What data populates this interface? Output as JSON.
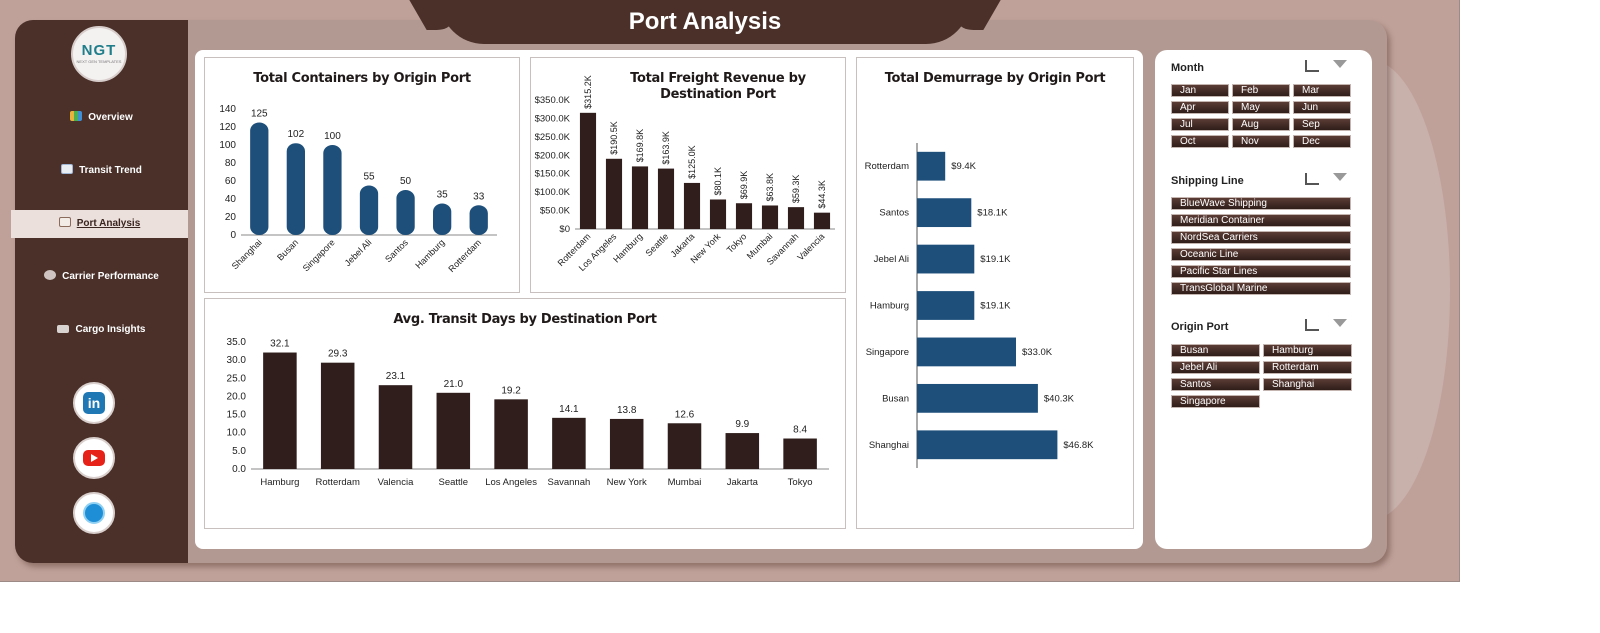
{
  "page_title": "Port Analysis",
  "logo": {
    "text": "NGT",
    "tagline": "NEXT GEN TEMPLATES"
  },
  "nav": [
    {
      "label": "Overview",
      "icon": "bar-chart-icon",
      "active": false
    },
    {
      "label": "Transit Trend",
      "icon": "line-chart-icon",
      "active": false
    },
    {
      "label": "Port Analysis",
      "icon": "document-icon",
      "active": true
    },
    {
      "label": "Carrier Performance",
      "icon": "gear-icon",
      "active": false
    },
    {
      "label": "Cargo Insights",
      "icon": "folder-icon",
      "active": false
    }
  ],
  "social": [
    {
      "icon": "linkedin-icon",
      "color": "#1f78b4"
    },
    {
      "icon": "youtube-icon",
      "color": "#e62117"
    },
    {
      "icon": "globe-icon",
      "color": "#1e8fd6"
    }
  ],
  "colors": {
    "brown_dark": "#4a3029",
    "bar_blue": "#1d4f7a",
    "bar_brown": "#2f1e1b"
  },
  "filters": {
    "month": {
      "title": "Month",
      "items": [
        "Jan",
        "Feb",
        "Mar",
        "Apr",
        "May",
        "Jun",
        "Jul",
        "Aug",
        "Sep",
        "Oct",
        "Nov",
        "Dec"
      ]
    },
    "shipping_line": {
      "title": "Shipping Line",
      "items": [
        "BlueWave Shipping",
        "Meridian Container",
        "NordSea Carriers",
        "Oceanic Line",
        "Pacific Star Lines",
        "TransGlobal Marine"
      ]
    },
    "origin_port": {
      "title": "Origin Port",
      "items": [
        "Busan",
        "Hamburg",
        "Jebel Ali",
        "Rotterdam",
        "Santos",
        "Shanghai",
        "Singapore"
      ]
    }
  },
  "chart_data": [
    {
      "type": "bar",
      "title": "Total Containers by Origin Port",
      "categories": [
        "Shanghai",
        "Busan",
        "Singapore",
        "Jebel Ali",
        "Santos",
        "Hamburg",
        "Rotterdam"
      ],
      "values": [
        125,
        102,
        100,
        55,
        50,
        35,
        33
      ],
      "labels": [
        "125",
        "102",
        "100",
        "55",
        "50",
        "35",
        "33"
      ],
      "yticks": [
        "0",
        "20",
        "40",
        "60",
        "80",
        "100",
        "120",
        "140"
      ],
      "ylim": [
        0,
        140
      ],
      "grid": false
    },
    {
      "type": "bar",
      "title": "Total Freight Revenue by Destination Port",
      "categories": [
        "Rotterdam",
        "Los Angeles",
        "Hamburg",
        "Seattle",
        "Jakarta",
        "New York",
        "Tokyo",
        "Mumbai",
        "Savannah",
        "Valencia"
      ],
      "values": [
        315.2,
        190.5,
        169.8,
        163.9,
        125.0,
        80.1,
        69.9,
        63.8,
        59.3,
        44.3
      ],
      "labels": [
        "$315.2K",
        "$190.5K",
        "$169.8K",
        "$163.9K",
        "$125.0K",
        "$80.1K",
        "$69.9K",
        "$63.8K",
        "$59.3K",
        "$44.3K"
      ],
      "yticks": [
        "$0",
        "$50.0K",
        "$100.0K",
        "$150.0K",
        "$200.0K",
        "$250.0K",
        "$300.0K",
        "$350.0K"
      ],
      "ylim": [
        0,
        350
      ],
      "grid": false
    },
    {
      "type": "bar",
      "orientation": "horizontal",
      "title": "Total Demurrage by Origin Port",
      "categories": [
        "Rotterdam",
        "Santos",
        "Jebel Ali",
        "Hamburg",
        "Singapore",
        "Busan",
        "Shanghai"
      ],
      "values": [
        9.4,
        18.1,
        19.1,
        19.1,
        33.0,
        40.3,
        46.8
      ],
      "labels": [
        "$9.4K",
        "$18.1K",
        "$19.1K",
        "$19.1K",
        "$33.0K",
        "$40.3K",
        "$46.8K"
      ],
      "xlim": [
        0,
        60
      ],
      "grid": false
    },
    {
      "type": "bar",
      "title": "Avg. Transit Days by Destination Port",
      "categories": [
        "Hamburg",
        "Rotterdam",
        "Valencia",
        "Seattle",
        "Los Angeles",
        "Savannah",
        "New York",
        "Mumbai",
        "Jakarta",
        "Tokyo"
      ],
      "values": [
        32.1,
        29.3,
        23.1,
        21.0,
        19.2,
        14.1,
        13.8,
        12.6,
        9.9,
        8.4
      ],
      "labels": [
        "32.1",
        "29.3",
        "23.1",
        "21.0",
        "19.2",
        "14.1",
        "13.8",
        "12.6",
        "9.9",
        "8.4"
      ],
      "yticks": [
        "0.0",
        "5.0",
        "10.0",
        "15.0",
        "20.0",
        "25.0",
        "30.0",
        "35.0"
      ],
      "ylim": [
        0,
        35
      ],
      "grid": false
    }
  ]
}
